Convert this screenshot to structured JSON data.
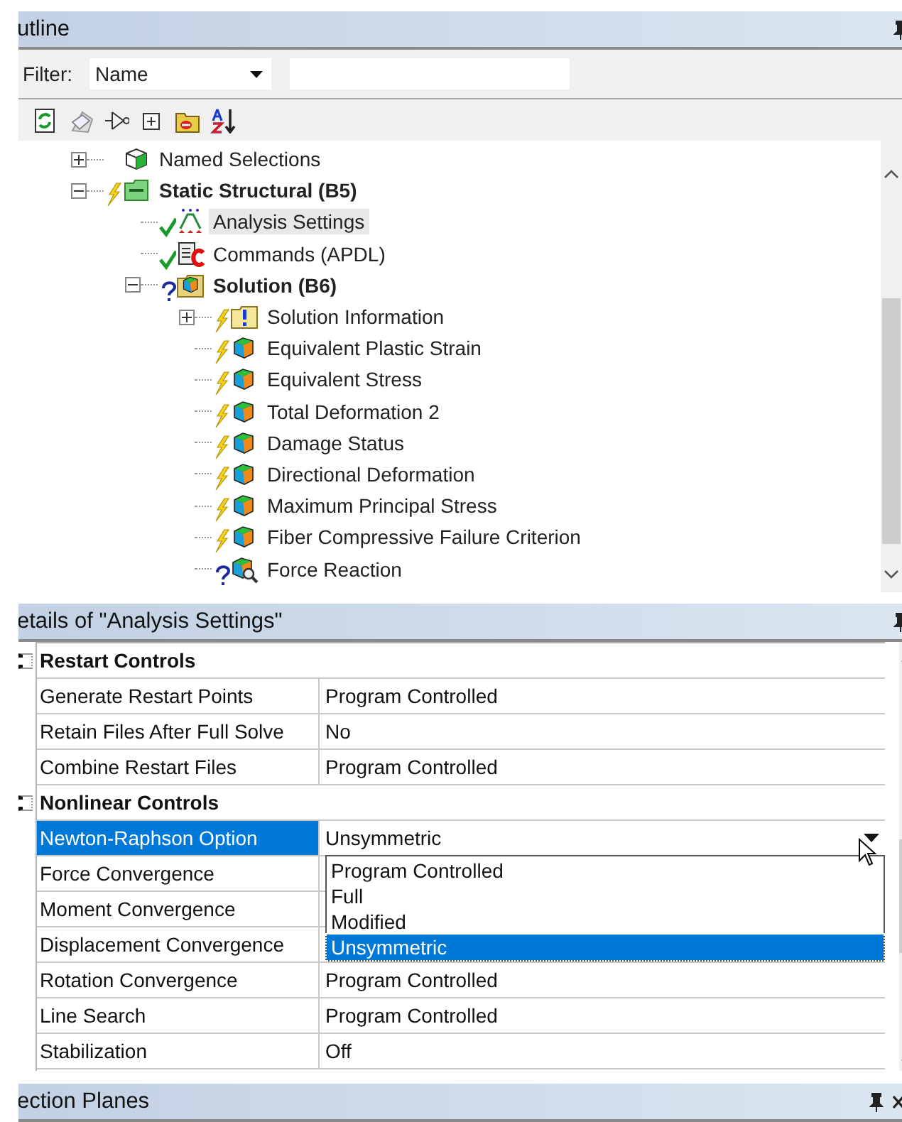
{
  "outline": {
    "title": "utline",
    "filter": {
      "label": "Filter:",
      "field": "Name"
    },
    "tree": [
      {
        "label": "Named Selections",
        "kind": "selections",
        "pending": false,
        "done": false,
        "unresolved": false,
        "expanded": false,
        "selected": false
      },
      {
        "label": "Static Structural (B5)",
        "kind": "environment",
        "pending": true,
        "done": false,
        "unresolved": false,
        "expanded": true,
        "selected": false,
        "children": [
          {
            "label": "Analysis Settings",
            "kind": "settings",
            "pending": false,
            "done": true,
            "unresolved": false,
            "selected": true
          },
          {
            "label": "Commands (APDL)",
            "kind": "commands",
            "pending": false,
            "done": true,
            "unresolved": false,
            "selected": false
          },
          {
            "label": "Solution (B6)",
            "kind": "solution",
            "pending": false,
            "done": false,
            "unresolved": true,
            "expanded": true,
            "selected": false,
            "children": [
              {
                "label": "Solution Information",
                "kind": "info",
                "pending": true,
                "done": false,
                "unresolved": false,
                "expanded": false,
                "selected": false
              },
              {
                "label": "Equivalent Plastic Strain",
                "kind": "result",
                "pending": true,
                "done": false,
                "unresolved": false,
                "selected": false
              },
              {
                "label": "Equivalent Stress",
                "kind": "result",
                "pending": true,
                "done": false,
                "unresolved": false,
                "selected": false
              },
              {
                "label": "Total Deformation 2",
                "kind": "result",
                "pending": true,
                "done": false,
                "unresolved": false,
                "selected": false
              },
              {
                "label": "Damage Status",
                "kind": "result",
                "pending": true,
                "done": false,
                "unresolved": false,
                "selected": false
              },
              {
                "label": "Directional Deformation",
                "kind": "result",
                "pending": true,
                "done": false,
                "unresolved": false,
                "selected": false
              },
              {
                "label": "Maximum Principal Stress",
                "kind": "result",
                "pending": true,
                "done": false,
                "unresolved": false,
                "selected": false
              },
              {
                "label": "Fiber Compressive Failure Criterion",
                "kind": "result",
                "pending": true,
                "done": false,
                "unresolved": false,
                "selected": false
              },
              {
                "label": "Force Reaction",
                "kind": "probe",
                "pending": false,
                "done": false,
                "unresolved": true,
                "selected": false
              }
            ]
          }
        ]
      }
    ]
  },
  "details": {
    "title": "etails of \"Analysis Settings\"",
    "rows": [
      {
        "kind": "group",
        "name": "Restart Controls",
        "expanded": true
      },
      {
        "kind": "property",
        "name": "Generate Restart Points",
        "value": "Program Controlled",
        "selected": false
      },
      {
        "kind": "property",
        "name": "Retain Files After Full Solve",
        "value": "No",
        "selected": false
      },
      {
        "kind": "property",
        "name": "Combine Restart Files",
        "value": "Program Controlled",
        "selected": false
      },
      {
        "kind": "group",
        "name": "Nonlinear Controls",
        "expanded": true
      },
      {
        "kind": "property",
        "name": "Newton-Raphson Option",
        "value": "Unsymmetric",
        "selected": true,
        "dropdown": {
          "options": [
            {
              "label": "Program Controlled",
              "selected": false
            },
            {
              "label": "Full",
              "selected": false
            },
            {
              "label": "Modified",
              "selected": false
            },
            {
              "label": "Unsymmetric",
              "selected": true
            }
          ]
        }
      },
      {
        "kind": "property",
        "name": "Force Convergence",
        "selected": false
      },
      {
        "kind": "property",
        "name": "Moment Convergence",
        "selected": false
      },
      {
        "kind": "property",
        "name": "Displacement Convergence",
        "selected": false
      },
      {
        "kind": "property",
        "name": "Rotation Convergence",
        "value": "Program Controlled",
        "selected": false
      },
      {
        "kind": "property",
        "name": "Line Search",
        "value": "Program Controlled",
        "selected": false
      },
      {
        "kind": "property",
        "name": "Stabilization",
        "value": "Off",
        "selected": false
      }
    ]
  },
  "section_planes": {
    "title": "ection Planes"
  }
}
